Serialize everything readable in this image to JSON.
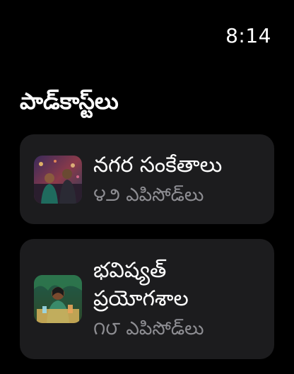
{
  "status": {
    "time": "8:14"
  },
  "page": {
    "title": "పాడ్‌కాస్ట్‌లు"
  },
  "podcasts": [
    {
      "title": "నగర సంకేతాలు",
      "episodes": "౪౨ ఎపిసోడ్‌లు",
      "artwork_icon": "city-couple-artwork-icon"
    },
    {
      "title": "భవిష్యత్ ప్రయోగశాల",
      "episodes": "౧౮ ఎపిసోడ్‌లు",
      "artwork_icon": "lab-scientist-artwork-icon"
    }
  ],
  "colors": {
    "background": "#000000",
    "card": "#1c1c1e",
    "secondary_text": "#8e8e93"
  }
}
